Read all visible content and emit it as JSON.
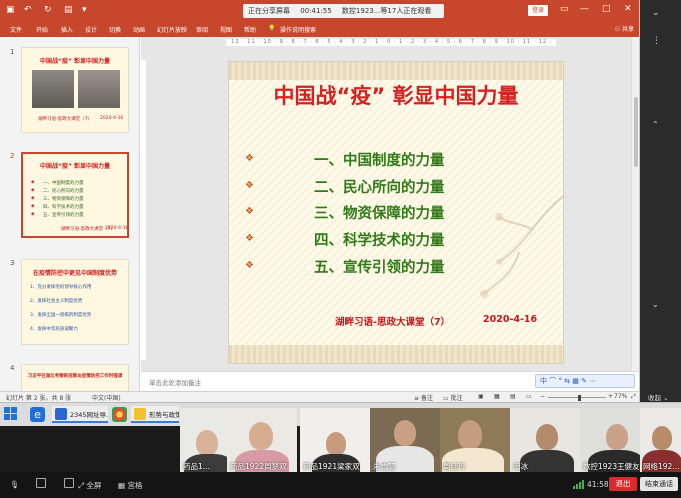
{
  "titlebar": {
    "share_status": "正在分享屏幕",
    "elapsed": "00:41:55",
    "meeting_info": "数控1923...等17人正在观看",
    "login": "登录"
  },
  "ribbon": {
    "tabs": [
      "文件",
      "开始",
      "插入",
      "设计",
      "切换",
      "动画",
      "幻灯片放映",
      "审阅",
      "视图",
      "帮助",
      "操作说明搜索"
    ],
    "share": "共享"
  },
  "thumbnails": [
    {
      "num": "1",
      "title": "中国战“疫” 彰显中国力量",
      "footer": "湖畔习语-思政大课堂（7）",
      "date": "2020-4-16"
    },
    {
      "num": "2",
      "title": "中国战“疫” 彰显中国力量",
      "items": [
        "一、中国制度的力量",
        "二、民心所向的力量",
        "三、物资保障的力量",
        "四、科学技术的力量",
        "五、宣传引领的力量"
      ],
      "footer": "湖畔习语-思政大课堂（7）",
      "date": "2020-4-16"
    },
    {
      "num": "3",
      "title": "在疫情防控中更见中国制度优势",
      "items": [
        "1、充分发挥党的领导核心作用",
        "2、发挥社会主义制度优势",
        "3、发挥全国一盘棋的制度优势",
        "4、发挥中华民族凝聚力"
      ],
      "footer": ""
    },
    {
      "num": "4",
      "title": "习近平在湖北考察新冠肺炎疫情防控工作时强调",
      "footer": ""
    }
  ],
  "ruler": "· 12 · 11 · 10 · 9 · 8 · 7 · 6 · 5 · 4 · 3 · 2 · 1 · 0 · 1 · 2 · 3 · 4 · 5 · 6 · 7 · 8 · 9 · 10 · 11 · 12 ·",
  "slide": {
    "title": "中国战“疫” 彰显中国力量",
    "bullet": "❖",
    "items": [
      "一、中国制度的力量",
      "二、民心所向的力量",
      "三、物资保障的力量",
      "四、科学技术的力量",
      "五、宣传引领的力量"
    ],
    "footer": "湖畔习语-思政大课堂（7）",
    "date": "2020-4-16"
  },
  "notes_placeholder": "单击此处添加备注",
  "ime": "中 ⌒ ° ⇆ ▦ ✎ ⋯",
  "statusbar": {
    "slide_info": "幻灯片 第 2 张，共 8 张",
    "language": "中文(中国)",
    "notes": "备注",
    "comments": "批注",
    "zoom": "77%"
  },
  "collapse": "收起",
  "taskbar": {
    "apps": [
      "2345网址导...",
      "形势与政策..."
    ]
  },
  "videos": [
    {
      "name": "药品1... ",
      "wall": "#e9e9e6",
      "face": "#d8b199",
      "body": "#3b3b3b"
    },
    {
      "name": "药品1922周梦双",
      "wall": "#ece8e3",
      "face": "#d7ad92",
      "body": "#d89aa4"
    },
    {
      "name": "药品1921梁家双",
      "wall": "#f0efec",
      "face": "#c99b7e",
      "body": "#2f2f2f"
    },
    {
      "name": "朱志慧",
      "wall": "#7b6b52",
      "face": "#c9a083",
      "body": "#e7e7e7"
    },
    {
      "name": "周佳玲",
      "wall": "#8f7a57",
      "face": "#c59c80",
      "body": "#f3e7d0"
    },
    {
      "name": "闫冰",
      "wall": "#e7e6e1",
      "face": "#b48a6c",
      "body": "#333333"
    },
    {
      "name": "数控1923王健友",
      "wall": "#dfdfdc",
      "face": "#c9a28a",
      "body": "#2a2a2a"
    },
    {
      "name": "网络192...",
      "wall": "#ebeae6",
      "face": "#b88b6b",
      "body": "#8a2f2f"
    }
  ],
  "controls": {
    "fullscreen": "全屏",
    "gallery": "宫格",
    "time": "41:58",
    "exit": "退出",
    "end": "结束通话"
  },
  "colors": {
    "ribbon": "#c6472c",
    "slide_title": "#d72020",
    "slide_items": "#2f7a17",
    "exit": "#d92b2b"
  }
}
